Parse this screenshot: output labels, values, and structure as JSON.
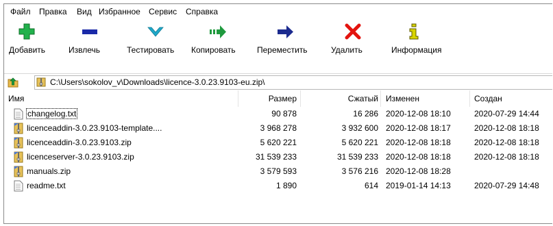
{
  "menu": [
    "Файл",
    "Правка",
    "Вид",
    "Избранное",
    "Сервис",
    "Справка"
  ],
  "toolbar": {
    "add": "Добавить",
    "extract": "Извлечь",
    "test": "Тестировать",
    "copy": "Копировать",
    "move": "Переместить",
    "delete": "Удалить",
    "info": "Информация"
  },
  "address": {
    "path": "C:\\Users\\sokolov_v\\Downloads\\licence-3.0.23.9103-eu.zip\\"
  },
  "columns": {
    "name": "Имя",
    "size": "Размер",
    "packed": "Сжатый",
    "modified": "Изменен",
    "created": "Создан"
  },
  "files": [
    {
      "name": "changelog.txt",
      "size": "90 878",
      "packed": "16 286",
      "modified": "2020-12-08 18:10",
      "created": "2020-07-29 14:44",
      "icon": "text-file-icon"
    },
    {
      "name": "licenceaddin-3.0.23.9103-template....",
      "size": "3 968 278",
      "packed": "3 932 600",
      "modified": "2020-12-08 18:17",
      "created": "2020-12-08 18:18",
      "icon": "zip-file-icon"
    },
    {
      "name": "licenceaddin-3.0.23.9103.zip",
      "size": "5 620 221",
      "packed": "5 620 221",
      "modified": "2020-12-08 18:18",
      "created": "2020-12-08 18:18",
      "icon": "zip-file-icon"
    },
    {
      "name": "licenceserver-3.0.23.9103.zip",
      "size": "31 539 233",
      "packed": "31 539 233",
      "modified": "2020-12-08 18:18",
      "created": "2020-12-08 18:18",
      "icon": "zip-file-icon"
    },
    {
      "name": "manuals.zip",
      "size": "3 579 593",
      "packed": "3 576 216",
      "modified": "2020-12-08 18:28",
      "created": "",
      "icon": "zip-file-icon"
    },
    {
      "name": "readme.txt",
      "size": "1 890",
      "packed": "614",
      "modified": "2019-01-14 14:13",
      "created": "2020-07-29 14:48",
      "icon": "text-file-icon"
    }
  ],
  "colors": {
    "add_green": "#22b14c",
    "extract_blue": "#1a2aa8",
    "test_cyan": "#1fa8c9",
    "copy_green": "#1f9a3e",
    "move_navy": "#1c2b8f",
    "delete_red": "#e3140f",
    "info_olive": "#5c5a00"
  }
}
